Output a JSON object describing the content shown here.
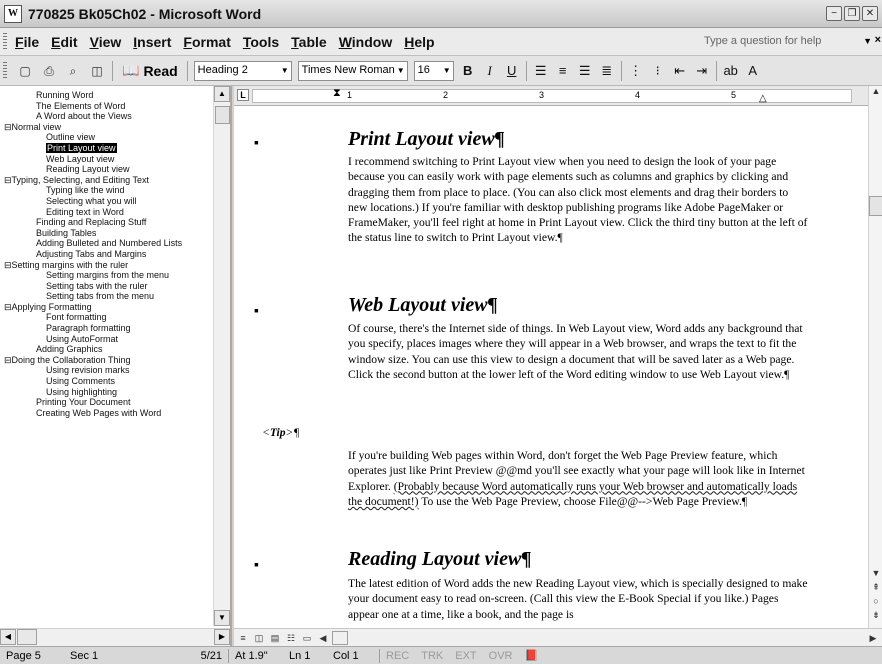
{
  "window": {
    "title": "770825 Bk05Ch02 - Microsoft Word",
    "app_icon": "word-icon",
    "buttons": [
      "−",
      "❐",
      "✕"
    ]
  },
  "menu": {
    "items": [
      "File",
      "Edit",
      "View",
      "Insert",
      "Format",
      "Tools",
      "Table",
      "Window",
      "Help"
    ],
    "help_placeholder": "Type a question for help",
    "help_close": "×"
  },
  "toolbar": {
    "read_label": "Read",
    "style_value": "Heading 2",
    "font_value": "Times New Roman",
    "size_value": "16",
    "bold": "B",
    "italic": "I",
    "underline": "U"
  },
  "docmap": {
    "items": [
      {
        "label": "Running Word",
        "level": 1
      },
      {
        "label": "The Elements of Word",
        "level": 1
      },
      {
        "label": "A Word about the Views",
        "level": 1
      },
      {
        "label": "⊟Normal view",
        "level": 0
      },
      {
        "label": "Outline view",
        "level": 2
      },
      {
        "label": "Print Layout view",
        "level": 2,
        "selected": true
      },
      {
        "label": "Web Layout view",
        "level": 2
      },
      {
        "label": "Reading Layout view",
        "level": 2
      },
      {
        "label": "⊟Typing, Selecting, and Editing Text",
        "level": 0
      },
      {
        "label": "Typing like the wind",
        "level": 2
      },
      {
        "label": "Selecting what you will",
        "level": 2
      },
      {
        "label": "Editing text in Word",
        "level": 2
      },
      {
        "label": "Finding and Replacing Stuff",
        "level": 1
      },
      {
        "label": "Building Tables",
        "level": 1
      },
      {
        "label": "Adding Bulleted and Numbered Lists",
        "level": 1
      },
      {
        "label": "Adjusting Tabs and Margins",
        "level": 1
      },
      {
        "label": "⊟Setting margins with the ruler",
        "level": 0
      },
      {
        "label": "Setting margins from the menu",
        "level": 2
      },
      {
        "label": "Setting tabs with the ruler",
        "level": 2
      },
      {
        "label": "Setting tabs from the menu",
        "level": 2
      },
      {
        "label": "⊟Applying Formatting",
        "level": 0
      },
      {
        "label": "Font formatting",
        "level": 2
      },
      {
        "label": "Paragraph formatting",
        "level": 2
      },
      {
        "label": "Using AutoFormat",
        "level": 2
      },
      {
        "label": "Adding Graphics",
        "level": 1
      },
      {
        "label": "⊟Doing the Collaboration Thing",
        "level": 0
      },
      {
        "label": "Using revision marks",
        "level": 2
      },
      {
        "label": "Using Comments",
        "level": 2
      },
      {
        "label": "Using highlighting",
        "level": 2
      },
      {
        "label": "Printing Your Document",
        "level": 1
      },
      {
        "label": "Creating Web Pages with Word",
        "level": 1
      }
    ]
  },
  "ruler": {
    "numbers": [
      "1",
      "2",
      "3",
      "4",
      "5"
    ]
  },
  "document": {
    "heading1": "Print Layout view¶",
    "para1": "I recommend switching to Print Layout view when you need to design the look of your page because you can easily work with page elements such as columns and graphics by clicking and dragging them from place to place. (You can also click most elements and drag their borders to new locations.) If you're familiar with desktop publishing programs like Adobe PageMaker or FrameMaker, you'll feel right at home in Print Layout view. Click the third tiny button at the left of the status line to switch to Print Layout view.¶",
    "heading2": "Web Layout view¶",
    "para2": "Of course, there's the Internet side of things. In Web Layout view, Word adds any background that you specify, places images where they will appear in a Web browser, and wraps the text to fit the window size. You can use this view to design a document that will be saved later as a Web page. Click the second button at the lower left of the Word editing window to use Web Layout view.¶",
    "tip_open": "<",
    "tip_word": "Tip",
    "tip_close": ">¶",
    "para3a": "If you're building Web pages within Word, don't forget the Web Page Preview feature, which operates just like Print Preview @@md you'll see exactly what your page will look like in Internet Explorer. ",
    "para3b": "(Probably because Word automatically runs your Web browser and automatically loads the document!)",
    "para3c": " To use the Web Page Preview, choose File@@-->Web Page Preview.¶",
    "heading3": "Reading Layout view¶",
    "para4": "The latest edition of Word adds the new Reading Layout view, which is specially designed to make your document easy to read on-screen. (Call this view the E-Book Special if you like.) Pages appear one at a time, like a book, and the page is"
  },
  "status": {
    "page": "Page 5",
    "sec": "Sec 1",
    "pages": "5/21",
    "at": "At 1.9\"",
    "ln": "Ln 1",
    "col": "Col 1",
    "rec": "REC",
    "trk": "TRK",
    "ext": "EXT",
    "ovr": "OVR",
    "lang_icon": "spelling-book-icon"
  }
}
